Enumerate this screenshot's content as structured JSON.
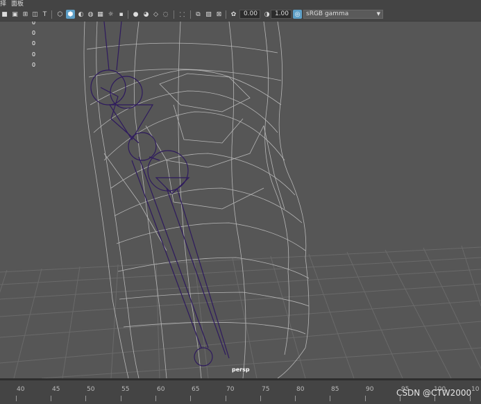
{
  "menubar": {
    "item0": "择",
    "item1": "面板"
  },
  "toolbar": {
    "exposure_value": "0.00",
    "gamma_value": "1.00",
    "color_space": "sRGB gamma",
    "icons": [
      "camera",
      "film",
      "grid",
      "gate",
      "text",
      "wireframe-cube",
      "smooth-shade",
      "half-circle",
      "hatch",
      "checker",
      "light",
      "shadow",
      "sphere-a",
      "sphere-b",
      "isolate",
      "xray",
      "grid-toggle",
      "image-plane",
      "scale",
      "exposure",
      "gamma",
      "colorspace"
    ]
  },
  "hud": {
    "rows": [
      {
        "value": "0"
      },
      {
        "value": "0"
      },
      {
        "value": "0"
      },
      {
        "value": "0"
      },
      {
        "value": "0"
      }
    ]
  },
  "viewport": {
    "camera_label": "persp",
    "background": "#565656",
    "wire_color": "#b8b8b8",
    "bone_color": "#2e1a5e"
  },
  "timeline": {
    "ticks": [
      "40",
      "45",
      "50",
      "55",
      "60",
      "65",
      "70",
      "75",
      "80",
      "85",
      "90",
      "95",
      "100",
      "10"
    ]
  },
  "watermark": "CSDN @CTW2000"
}
